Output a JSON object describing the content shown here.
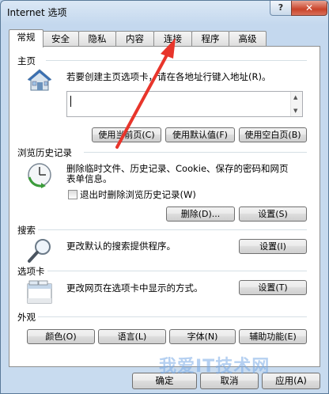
{
  "window": {
    "title": "Internet 选项",
    "help_label": "?",
    "close_label": "✕"
  },
  "tabs": [
    "常规",
    "安全",
    "隐私",
    "内容",
    "连接",
    "程序",
    "高级"
  ],
  "home": {
    "section_label": "主页",
    "description": "若要创建主页选项卡，请在各地址行键入地址(R)。",
    "url_value": "",
    "buttons": {
      "use_current": "使用当前页(C)",
      "use_default": "使用默认值(F)",
      "use_blank": "使用空白页(B)"
    }
  },
  "history": {
    "section_label": "浏览历史记录",
    "description_line1": "删除临时文件、历史记录、Cookie、保存的密码和网页",
    "description_line2": "表单信息。",
    "checkbox_label": "退出时删除浏览历史记录(W)",
    "checkbox_checked": false,
    "delete_button": "删除(D)...",
    "settings_button": "设置(S)"
  },
  "search": {
    "section_label": "搜索",
    "description": "更改默认的搜索提供程序。",
    "settings_button": "设置(I)"
  },
  "tabs_section": {
    "section_label": "选项卡",
    "description": "更改网页在选项卡中显示的方式。",
    "settings_button": "设置(T)"
  },
  "appearance": {
    "section_label": "外观",
    "buttons": {
      "colors": "颜色(O)",
      "languages": "语言(L)",
      "fonts": "字体(N)",
      "accessibility": "辅助功能(E)"
    }
  },
  "footer": {
    "ok": "确定",
    "cancel": "取消",
    "apply": "应用(A)"
  },
  "watermark": "我爱IT技术网",
  "colors": {
    "annotation_arrow": "#e8352b",
    "title_gradient_top": "#dbe8f5",
    "close_button": "#c9432a"
  },
  "icons": {
    "home": "house-icon",
    "history": "clock-icon",
    "search": "magnifier-icon",
    "tabs": "tab-window-icon"
  }
}
